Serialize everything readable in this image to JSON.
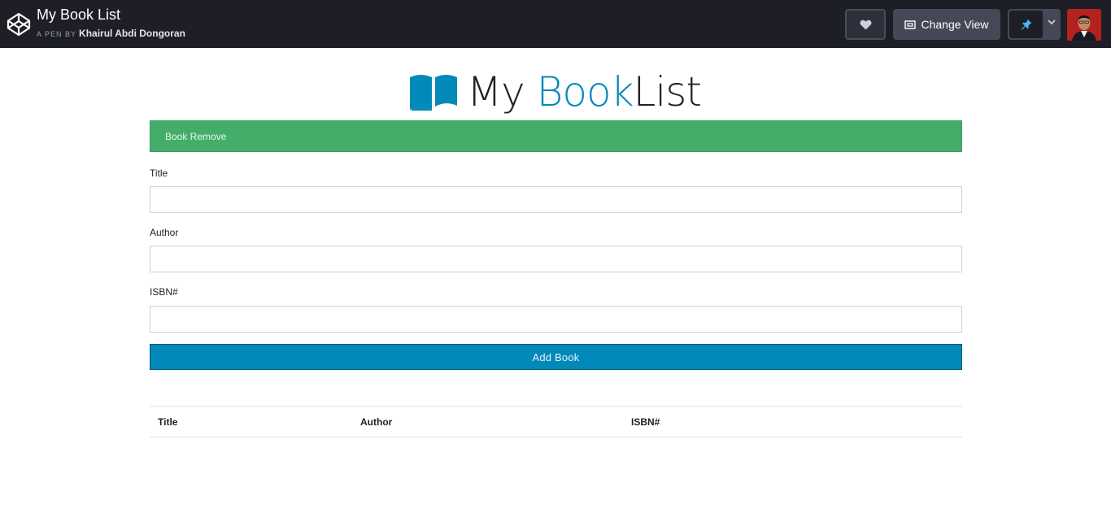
{
  "header": {
    "pen_title": "My Book List",
    "byline_prefix": "A PEN BY",
    "author_name": "Khairul Abdi Dongoran",
    "change_view_label": "Change View",
    "icons": [
      "codepen-logo-icon",
      "heart-icon",
      "change-view-icon",
      "pin-icon",
      "chevron-down-icon",
      "avatar"
    ]
  },
  "page": {
    "heading_part1": "My ",
    "heading_part2": "Book",
    "heading_part3": "List",
    "heading_icon": "book-open-icon",
    "accent_color": "#0189b9",
    "alert": {
      "message": "Book Remove",
      "color": "#44ad6a"
    },
    "form": {
      "title_label": "Title",
      "title_value": "",
      "author_label": "Author",
      "author_value": "",
      "isbn_label": "ISBN#",
      "isbn_value": "",
      "submit_label": "Add Book"
    },
    "table": {
      "columns": [
        "Title",
        "Author",
        "ISBN#"
      ],
      "rows": []
    }
  }
}
